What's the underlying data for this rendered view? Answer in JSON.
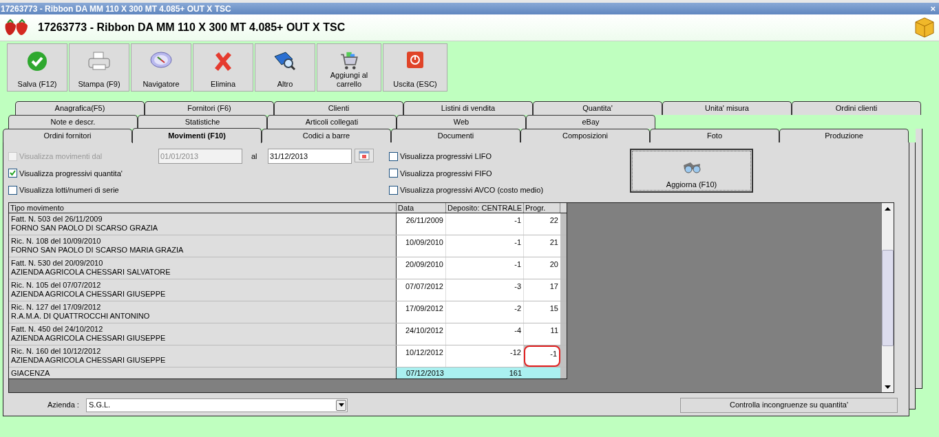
{
  "window": {
    "title": "17263773 - Ribbon DA MM 110 X 300 MT 4.085+ OUT X TSC",
    "close": "×"
  },
  "header": {
    "title": "17263773 - Ribbon DA MM 110 X 300 MT 4.085+ OUT X TSC"
  },
  "toolbar": [
    {
      "kind": "check",
      "label": "Salva (F12)"
    },
    {
      "kind": "printer",
      "label": "Stampa (F9)"
    },
    {
      "kind": "compass",
      "label": "Navigatore"
    },
    {
      "kind": "cross",
      "label": "Elimina"
    },
    {
      "kind": "book",
      "label": "Altro"
    },
    {
      "kind": "cart",
      "label": "Aggiungi al carrello"
    },
    {
      "kind": "power",
      "label": "Uscita (ESC)"
    }
  ],
  "tab_rows": [
    [
      {
        "label": "Anagrafica(F5)",
        "selected": false
      },
      {
        "label": "Fornitori (F6)",
        "selected": false
      },
      {
        "label": "Clienti",
        "selected": false
      },
      {
        "label": "Listini di vendita",
        "selected": false
      },
      {
        "label": "Quantita'",
        "selected": false
      },
      {
        "label": "Unita' misura",
        "selected": false
      },
      {
        "label": "Ordini clienti",
        "selected": false
      }
    ],
    [
      {
        "label": "Note e descr.",
        "selected": false
      },
      {
        "label": "Statistiche",
        "selected": false
      },
      {
        "label": "Articoli collegati",
        "selected": false
      },
      {
        "label": "Web",
        "selected": false
      },
      {
        "label": "eBay",
        "selected": false
      }
    ],
    [
      {
        "label": "Ordini fornitori",
        "selected": false
      },
      {
        "label": "Movimenti (F10)",
        "selected": true
      },
      {
        "label": "Codici a barre",
        "selected": false
      },
      {
        "label": "Documenti",
        "selected": false
      },
      {
        "label": "Composizioni",
        "selected": false
      },
      {
        "label": "Foto",
        "selected": false
      },
      {
        "label": "Produzione",
        "selected": false
      }
    ]
  ],
  "filters": {
    "from": {
      "label": "Visualizza movimenti dal",
      "checked": false,
      "disabled": true
    },
    "from_date": {
      "value": "01/01/2013",
      "disabled": true
    },
    "to_label": "al",
    "to_date": {
      "value": "31/12/2013"
    },
    "left_options": [
      {
        "label": "Visualizza progressivi quantita'",
        "checked": true
      },
      {
        "label": "Visualizza lotti/numeri di serie",
        "checked": false
      }
    ],
    "right_options": [
      {
        "label": "Visualizza progressivi LIFO",
        "checked": false
      },
      {
        "label": "Visualizza progressivi FIFO",
        "checked": false
      },
      {
        "label": "Visualizza progressivi AVCO (costo medio)",
        "checked": false
      }
    ],
    "refresh": "Aggiorna (F10)"
  },
  "table": {
    "columns": [
      "Tipo movimento",
      "Data",
      "Deposito: CENTRALE",
      "Progr."
    ],
    "rows": [
      {
        "doc": "Fatt. N. 503 del 26/11/2009",
        "party": "FORNO SAN PAOLO DI SCARSO GRAZIA",
        "date": "26/11/2009",
        "qty": "-1",
        "progr": "22",
        "highlighted": false
      },
      {
        "doc": "Ric. N. 108 del 10/09/2010",
        "party": "FORNO SAN PAOLO DI SCARSO MARIA GRAZIA",
        "date": "10/09/2010",
        "qty": "-1",
        "progr": "21",
        "highlighted": false
      },
      {
        "doc": "Fatt. N. 530 del 20/09/2010",
        "party": "AZIENDA AGRICOLA CHESSARI SALVATORE",
        "date": "20/09/2010",
        "qty": "-1",
        "progr": "20",
        "highlighted": false
      },
      {
        "doc": "Ric. N. 105 del 07/07/2012",
        "party": "AZIENDA AGRICOLA CHESSARI GIUSEPPE",
        "date": "07/07/2012",
        "qty": "-3",
        "progr": "17",
        "highlighted": false
      },
      {
        "doc": "Ric. N. 127 del 17/09/2012",
        "party": "R.A.M.A. DI QUATTROCCHI ANTONINO",
        "date": "17/09/2012",
        "qty": "-2",
        "progr": "15",
        "highlighted": false
      },
      {
        "doc": "Fatt. N. 450 del 24/10/2012",
        "party": "AZIENDA AGRICOLA CHESSARI GIUSEPPE",
        "date": "24/10/2012",
        "qty": "-4",
        "progr": "11",
        "highlighted": false
      },
      {
        "doc": "Ric. N. 160 del 10/12/2012",
        "party": "AZIENDA AGRICOLA CHESSARI GIUSEPPE",
        "date": "10/12/2012",
        "qty": "-12",
        "progr": "-1",
        "highlighted": true
      }
    ],
    "total": {
      "label": "GIACENZA",
      "date": "07/12/2013",
      "qty": "161"
    }
  },
  "footer": {
    "company_label": "Azienda :",
    "company": "S.G.L.",
    "check_button": "Controlla incongruenze su quantita'"
  }
}
